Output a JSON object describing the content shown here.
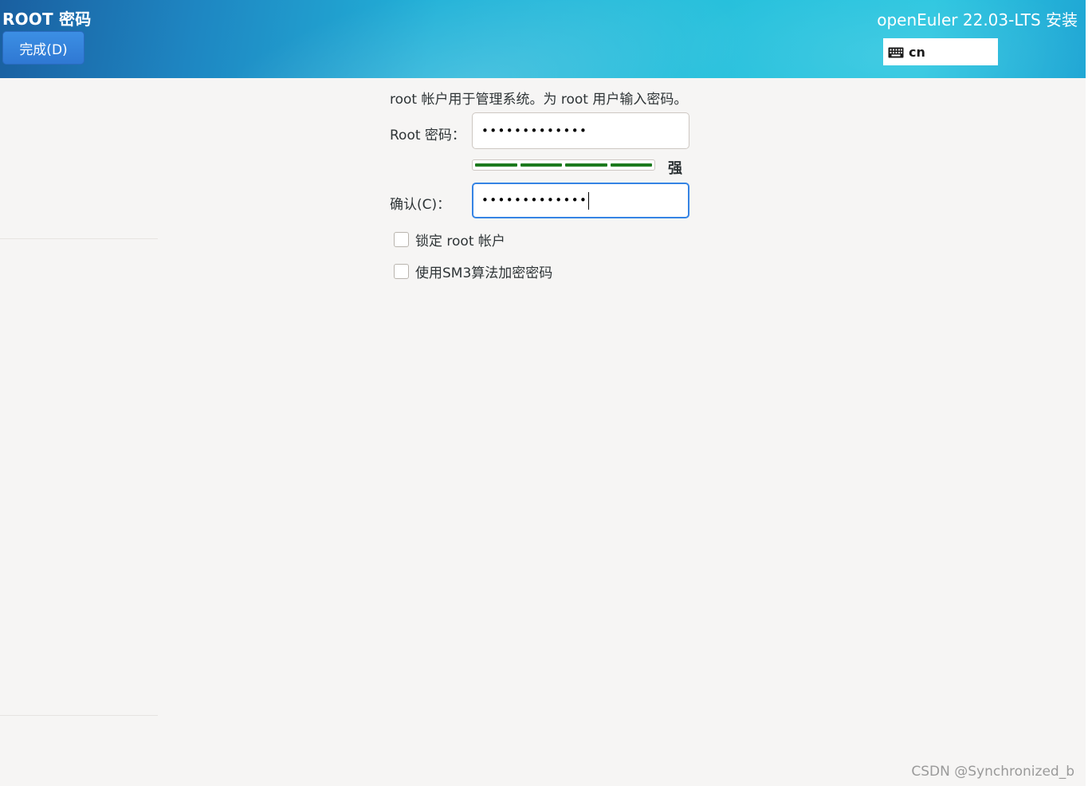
{
  "header": {
    "spoke_title": "ROOT 密码",
    "done_label": "完成(D)",
    "product_title": "openEuler 22.03-LTS 安装",
    "keyboard_layout": "cn",
    "keyboard_icon": "keyboard-icon"
  },
  "form": {
    "intro": "root 帐户用于管理系统。为 root 用户输入密码。",
    "password_label": "Root 密码：",
    "password_value": "•••••••••••••",
    "strength": {
      "label": "强",
      "level": 4,
      "max_level": 4,
      "color": "#1c7a1e"
    },
    "confirm_label": "确认(C)：",
    "confirm_value": "•••••••••••••",
    "lock_root_label": "锁定 root 帐户",
    "lock_root_checked": false,
    "sm3_label": "使用SM3算法加密密码",
    "sm3_checked": false
  },
  "watermark": "CSDN @Synchronized_b",
  "colors": {
    "focus": "#3584e4",
    "button": "#3584e4",
    "header_accent": "#22b2d8"
  }
}
